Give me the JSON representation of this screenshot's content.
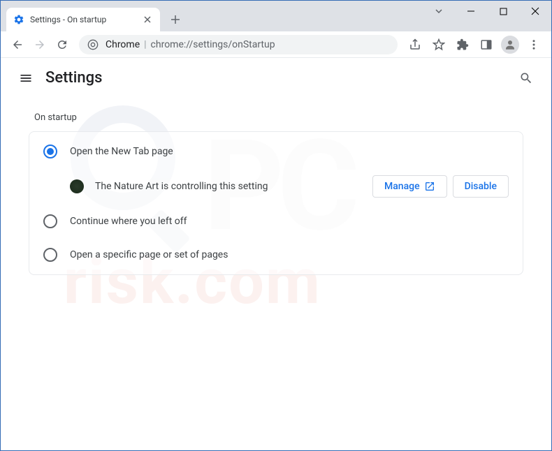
{
  "tab": {
    "title": "Settings - On startup"
  },
  "omnibox": {
    "prefix": "Chrome",
    "url": "chrome://settings/onStartup"
  },
  "header": {
    "title": "Settings"
  },
  "section": {
    "title": "On startup"
  },
  "options": {
    "opt1": "Open the New Tab page",
    "opt2": "Continue where you left off",
    "opt3": "Open a specific page or set of pages"
  },
  "extension": {
    "message": "The Nature Art is controlling this setting",
    "manage": "Manage",
    "disable": "Disable"
  },
  "watermark": {
    "line1": "PC",
    "line2": "risk.com"
  }
}
